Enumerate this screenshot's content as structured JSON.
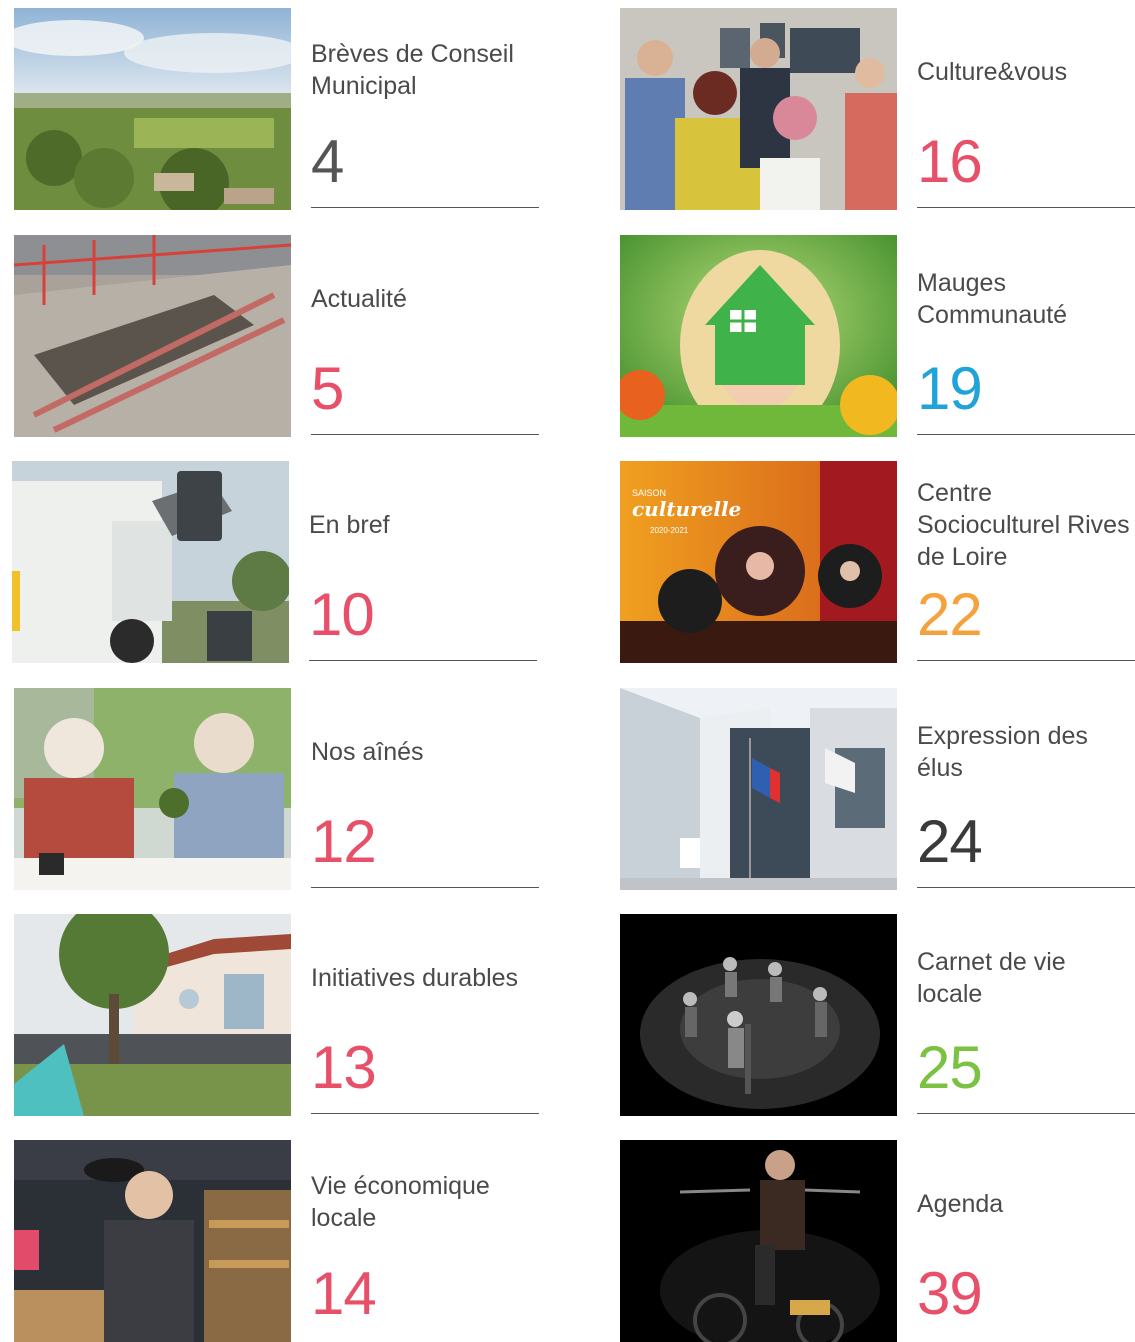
{
  "toc": {
    "left": [
      {
        "title": "Brèves de Conseil\nMunicipal",
        "page": "4",
        "color": "#555555"
      },
      {
        "title": "Actualité",
        "page": "5",
        "color": "#e8506a"
      },
      {
        "title": "En bref",
        "page": "10",
        "color": "#e8506a"
      },
      {
        "title": "Nos aînés",
        "page": "12",
        "color": "#e8506a"
      },
      {
        "title": "Initiatives durables",
        "page": "13",
        "color": "#e8506a"
      },
      {
        "title": "Vie économique\nlocale",
        "page": "14",
        "color": "#e8506a"
      }
    ],
    "right": [
      {
        "title": "Culture&vous",
        "page": "16",
        "color": "#e8506a"
      },
      {
        "title": "Mauges\nCommunauté",
        "page": "19",
        "color": "#1fa3d8"
      },
      {
        "title": "Centre\nSocioculturel Rives\nde Loire",
        "page": "22",
        "color": "#f5a23c"
      },
      {
        "title": "Expression des\nélus",
        "page": "24",
        "color": "#3a3a3a"
      },
      {
        "title": "Carnet de vie\nlocale",
        "page": "25",
        "color": "#7cc242"
      },
      {
        "title": "Agenda",
        "page": "39",
        "color": "#e8506a"
      }
    ]
  },
  "photo_text": {
    "saison": "SAISON",
    "culturelle": "culturelle",
    "years": "2020-2021"
  }
}
